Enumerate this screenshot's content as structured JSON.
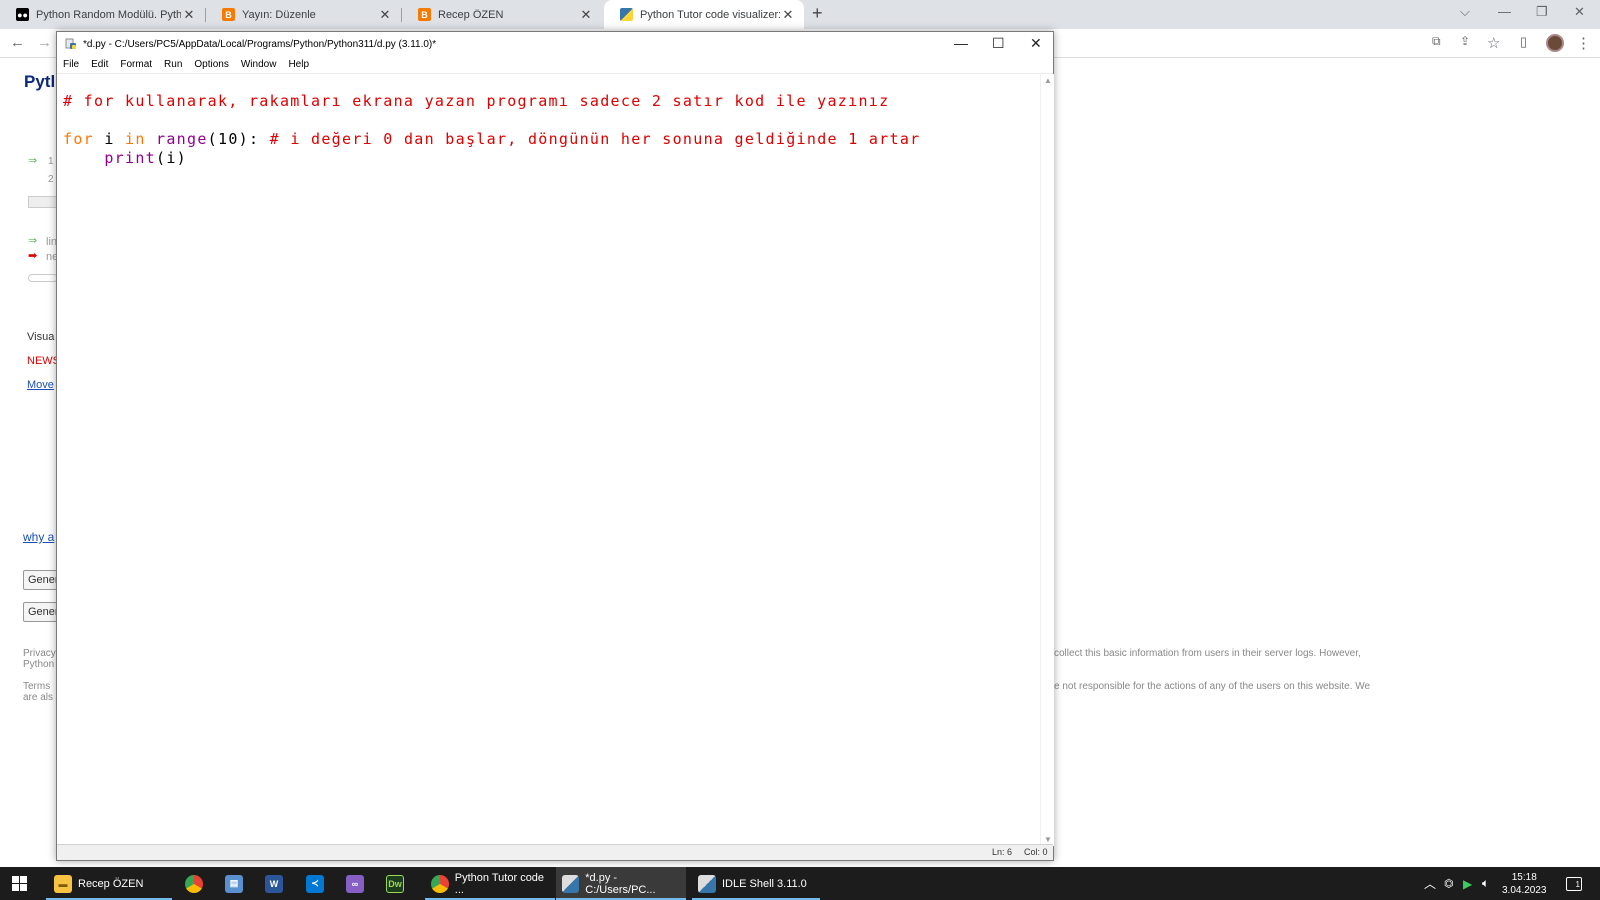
{
  "browser": {
    "tabs": [
      {
        "title": "Python Random Modülü. Python",
        "favicon": "medium-icon",
        "color": "#000000"
      },
      {
        "title": "Yayın: Düzenle",
        "favicon": "blogger-icon",
        "color": "#f57c00"
      },
      {
        "title": "Recep ÖZEN",
        "favicon": "blogger-icon",
        "color": "#f57c00"
      },
      {
        "title": "Python Tutor code visualizer: Vis",
        "favicon": "python-icon",
        "color": "#3776ab"
      }
    ],
    "background_page": {
      "heading_fragment": "Pytl",
      "line1": "1",
      "line2": "2",
      "legend_green": "lin",
      "legend_red": "ne",
      "visua": "Visua",
      "news": "NEWS",
      "move": "Move",
      "why": "why a",
      "gen1": "Gener",
      "gen2": "Gener",
      "privacy": "Privacy",
      "python": "Python",
      "terms": "Terms",
      "are": "are als",
      "footer1": "collect this basic information from users in their server logs. However,",
      "footer2": "e not responsible for the actions of any of the users on this website. We"
    }
  },
  "idle": {
    "title": "*d.py - C:/Users/PC5/AppData/Local/Programs/Python/Python311/d.py (3.11.0)*",
    "menu": [
      "File",
      "Edit",
      "Format",
      "Run",
      "Options",
      "Window",
      "Help"
    ],
    "code": {
      "line1_comment": "# for kullanarak, rakamları ekrana yazan programı sadece 2 satır kod ile yazınız",
      "line3_for": "for",
      "line3_i": " i ",
      "line3_in": "in",
      "line3_sp": " ",
      "line3_range": "range",
      "line3_args": "(10): ",
      "line3_comment": "# i değeri 0 dan başlar, döngünün her sonuna geldiğinde 1 artar",
      "line4_indent": "    ",
      "line4_print": "print",
      "line4_args": "(i)"
    },
    "status": {
      "ln": "Ln: 6",
      "col": "Col: 0"
    }
  },
  "taskbar": {
    "items": [
      {
        "label": "Recep ÖZEN",
        "icon": "folder-icon"
      },
      {
        "label": "Python Tutor code ...",
        "icon": "chrome-icon"
      },
      {
        "label": "*d.py - C:/Users/PC...",
        "icon": "idle-icon"
      },
      {
        "label": "IDLE Shell 3.11.0",
        "icon": "idle-icon"
      }
    ],
    "time": "15:18",
    "date": "3.04.2023",
    "notif_count": "1"
  }
}
